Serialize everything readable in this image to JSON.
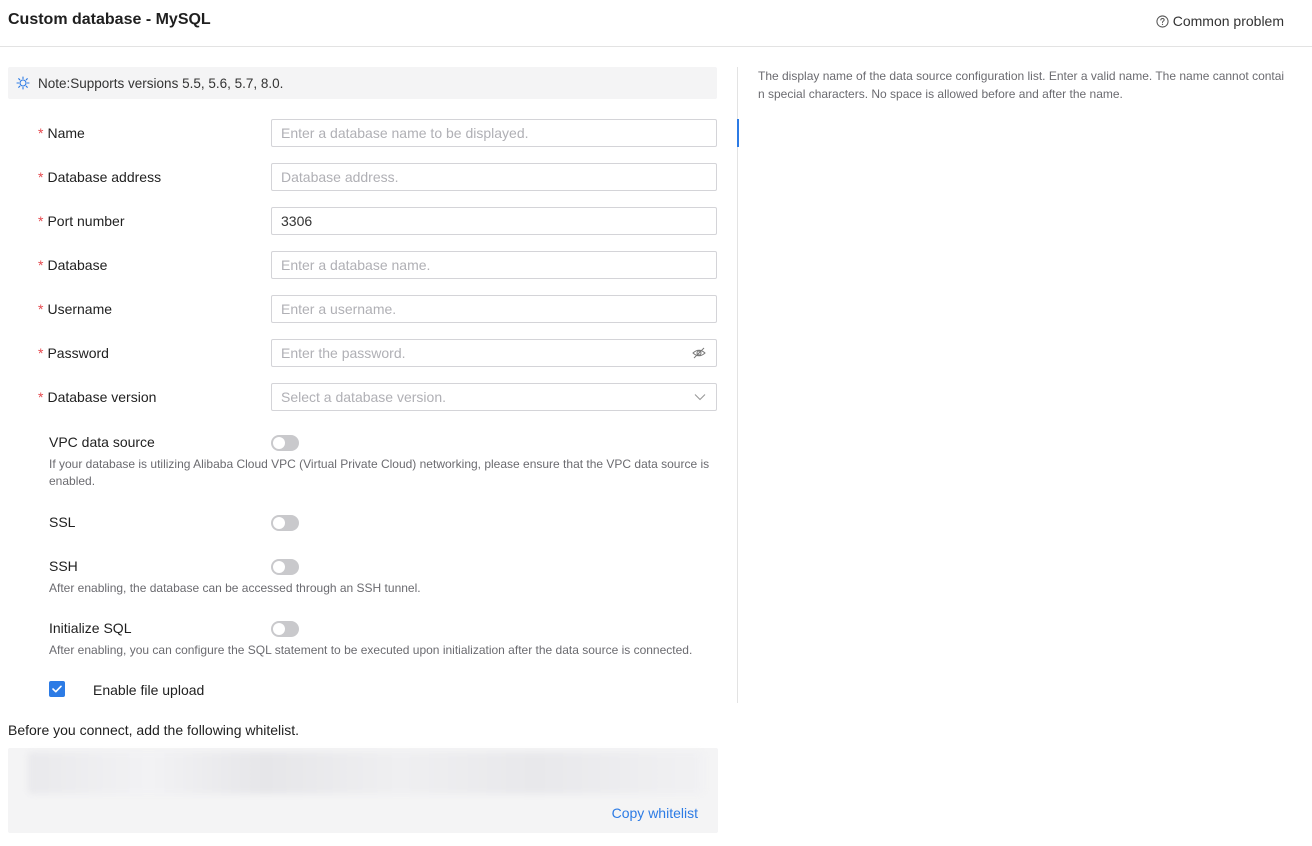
{
  "header": {
    "title": "Custom database - MySQL",
    "help_label": "Common problem"
  },
  "note": {
    "text": "Note:Supports versions 5.5, 5.6, 5.7, 8.0."
  },
  "form": {
    "name": {
      "label": "Name",
      "placeholder": "Enter a database name to be displayed.",
      "value": ""
    },
    "address": {
      "label": "Database address",
      "placeholder": "Database address.",
      "value": ""
    },
    "port": {
      "label": "Port number",
      "placeholder": "",
      "value": "3306"
    },
    "database": {
      "label": "Database",
      "placeholder": "Enter a database name.",
      "value": ""
    },
    "username": {
      "label": "Username",
      "placeholder": "Enter a username.",
      "value": ""
    },
    "password": {
      "label": "Password",
      "placeholder": "Enter the password.",
      "value": ""
    },
    "version": {
      "label": "Database version",
      "placeholder": "Select a database version."
    }
  },
  "toggles": {
    "vpc": {
      "label": "VPC data source",
      "hint": "If your database is utilizing Alibaba Cloud VPC (Virtual Private Cloud) networking, please ensure that the VPC data source is enabled.",
      "enabled": false
    },
    "ssl": {
      "label": "SSL",
      "enabled": false
    },
    "ssh": {
      "label": "SSH",
      "hint": "After enabling, the database can be accessed through an SSH tunnel.",
      "enabled": false
    },
    "init_sql": {
      "label": "Initialize SQL",
      "hint": "After enabling, you can configure the SQL statement to be executed upon initialization after the data source is connected.",
      "enabled": false
    }
  },
  "file_upload": {
    "label": "Enable file upload",
    "checked": true
  },
  "whitelist": {
    "title": "Before you connect, add the following whitelist.",
    "copy_label": "Copy whitelist"
  },
  "side_help": {
    "text": "The display name of the data source configuration list. Enter a valid name. The name cannot contain special characters. No space is allowed before and after the name."
  },
  "colors": {
    "accent": "#2c7be5",
    "required": "#e5484d"
  }
}
